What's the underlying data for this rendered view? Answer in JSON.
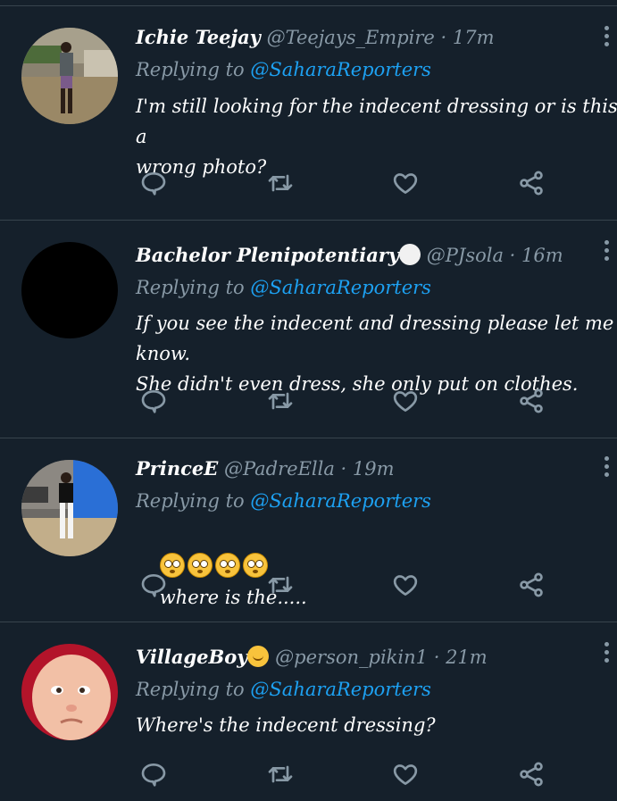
{
  "tweets": [
    {
      "name": "Ichie Teejay",
      "handle": "@Teejays_Empire",
      "time": "17m",
      "replying_to_label": "Replying to",
      "replying_to_handle": "@SaharaReporters",
      "text": "I'm still looking for the indecent dressing or is this a\nwrong photo?"
    },
    {
      "name": "Bachelor Plenipotentiary",
      "handle": "@PJsola",
      "time": "16m",
      "replying_to_label": "Replying to",
      "replying_to_handle": "@SaharaReporters",
      "text": "If you see the indecent and dressing please let me know.\nShe didn't even dress, she only put on clothes."
    },
    {
      "name": "PrinceE",
      "handle": "@PadreElla",
      "time": "19m",
      "replying_to_label": "Replying to",
      "replying_to_handle": "@SaharaReporters",
      "text": "where is the....."
    },
    {
      "name": "VillageBoy",
      "handle": "@person_pikin1",
      "time": "21m",
      "replying_to_label": "Replying to",
      "replying_to_handle": "@SaharaReporters",
      "text": "Where's the indecent dressing?"
    }
  ],
  "separator": "·",
  "icons": {
    "reply": "reply-icon",
    "retweet": "retweet-icon",
    "like": "heart-icon",
    "share": "share-icon",
    "more": "more-options-icon"
  },
  "colors": {
    "background": "#15202b",
    "secondary_text": "#8899a6",
    "mention": "#1da1f2",
    "divider": "#38444d"
  }
}
